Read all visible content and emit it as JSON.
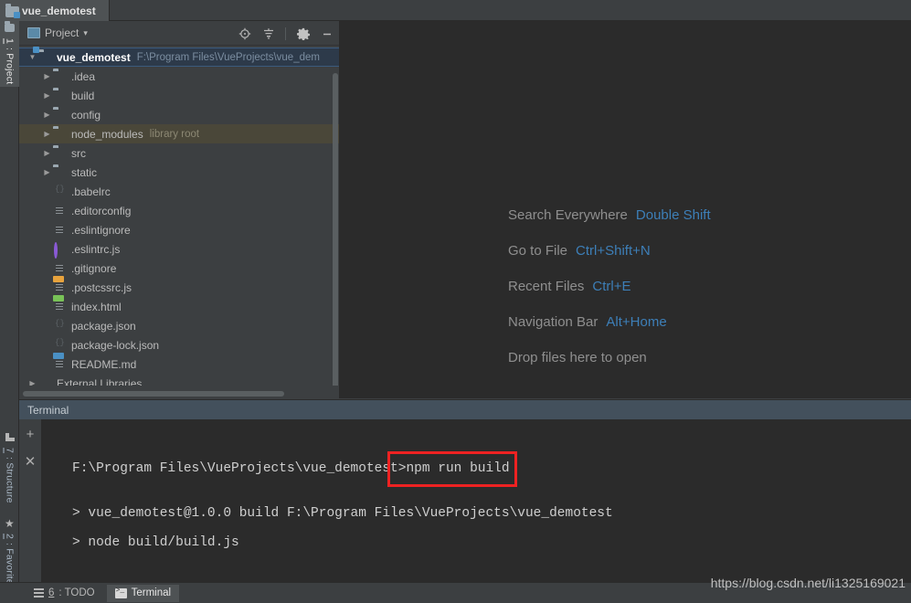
{
  "window": {
    "project_tab": "vue_demotest"
  },
  "left_tool_strip": {
    "tabs": [
      {
        "num": "1",
        "label": ": Project",
        "icon": "project-folder-icon",
        "active": true
      },
      {
        "num": "7",
        "label": ": Structure",
        "icon": "structure-icon",
        "active": false
      },
      {
        "num": "2",
        "label": ": Favorites",
        "icon": "star-icon",
        "active": false
      }
    ]
  },
  "project_panel": {
    "title": "Project",
    "dropdown_caret": "▾",
    "header_icons": [
      "locate-target-icon",
      "collapse-all-icon",
      "gear-icon",
      "minimize-icon"
    ],
    "tree": [
      {
        "name": "vue_demotest",
        "detail": "F:\\Program Files\\VueProjects\\vue_dem",
        "icon": "module-folder-icon",
        "arrow": "▼",
        "state": "selected",
        "depth": 0
      },
      {
        "name": ".idea",
        "detail": "",
        "icon": "folder-icon",
        "arrow": "▶",
        "state": "normal",
        "depth": 1
      },
      {
        "name": "build",
        "detail": "",
        "icon": "folder-icon",
        "arrow": "▶",
        "state": "normal",
        "depth": 1
      },
      {
        "name": "config",
        "detail": "",
        "icon": "folder-icon",
        "arrow": "▶",
        "state": "normal",
        "depth": 1
      },
      {
        "name": "node_modules",
        "detail": "library root",
        "icon": "folder-icon",
        "arrow": "▶",
        "state": "library",
        "depth": 1
      },
      {
        "name": "src",
        "detail": "",
        "icon": "folder-icon",
        "arrow": "▶",
        "state": "normal",
        "depth": 1
      },
      {
        "name": "static",
        "detail": "",
        "icon": "folder-icon",
        "arrow": "▶",
        "state": "normal",
        "depth": 1
      },
      {
        "name": ".babelrc",
        "detail": "",
        "icon": "json-file-icon",
        "arrow": "",
        "state": "normal",
        "depth": 1
      },
      {
        "name": ".editorconfig",
        "detail": "",
        "icon": "text-file-icon",
        "arrow": "",
        "state": "normal",
        "depth": 1
      },
      {
        "name": ".eslintignore",
        "detail": "",
        "icon": "text-file-icon",
        "arrow": "",
        "state": "normal",
        "depth": 1
      },
      {
        "name": ".eslintrc.js",
        "detail": "",
        "icon": "eslint-circle-icon",
        "arrow": "",
        "state": "normal",
        "depth": 1
      },
      {
        "name": ".gitignore",
        "detail": "",
        "icon": "text-file-icon",
        "arrow": "",
        "state": "normal",
        "depth": 1
      },
      {
        "name": ".postcssrc.js",
        "detail": "",
        "icon": "js-file-icon",
        "arrow": "",
        "state": "normal",
        "depth": 1
      },
      {
        "name": "index.html",
        "detail": "",
        "icon": "html-file-icon",
        "arrow": "",
        "state": "normal",
        "depth": 1
      },
      {
        "name": "package.json",
        "detail": "",
        "icon": "json-file-icon",
        "arrow": "",
        "state": "normal",
        "depth": 1
      },
      {
        "name": "package-lock.json",
        "detail": "",
        "icon": "json-file-icon",
        "arrow": "",
        "state": "normal",
        "depth": 1
      },
      {
        "name": "README.md",
        "detail": "",
        "icon": "md-file-icon",
        "arrow": "",
        "state": "normal",
        "depth": 1
      },
      {
        "name": "External Libraries",
        "detail": "",
        "icon": "libraries-icon",
        "arrow": "▶",
        "state": "normal",
        "depth": 0
      }
    ]
  },
  "editor": {
    "shortcuts": [
      {
        "action": "Search Everywhere",
        "key": "Double Shift"
      },
      {
        "action": "Go to File",
        "key": "Ctrl+Shift+N"
      },
      {
        "action": "Recent Files",
        "key": "Ctrl+E"
      },
      {
        "action": "Navigation Bar",
        "key": "Alt+Home"
      },
      {
        "action": "Drop files here to open",
        "key": ""
      }
    ]
  },
  "terminal": {
    "header_title": "Terminal",
    "side_buttons": [
      "add-tab-icon",
      "close-tab-icon"
    ],
    "prompt_path": "F:\\Program Files\\VueProjects\\vue_demotest>",
    "command": "npm run build",
    "output_lines": [
      "> vue_demotest@1.0.0 build F:\\Program Files\\VueProjects\\vue_demotest",
      "> node build/build.js"
    ],
    "highlight_color": "#ee2222"
  },
  "status_bar": {
    "tabs": [
      {
        "num": "6",
        "label": ": TODO",
        "icon": "todo-list-icon",
        "active": false
      },
      {
        "num": "",
        "label": "Terminal",
        "icon": "terminal-icon",
        "active": true
      }
    ]
  },
  "watermark": "https://blog.csdn.net/li1325169021",
  "colors": {
    "panel_bg": "#3c3f41",
    "editor_bg": "#2b2b2b",
    "selection_blue": "#2d3a4a",
    "library_highlight": "#4a4739",
    "accent_link": "#3d7fb8",
    "terminal_header": "#43505c"
  }
}
